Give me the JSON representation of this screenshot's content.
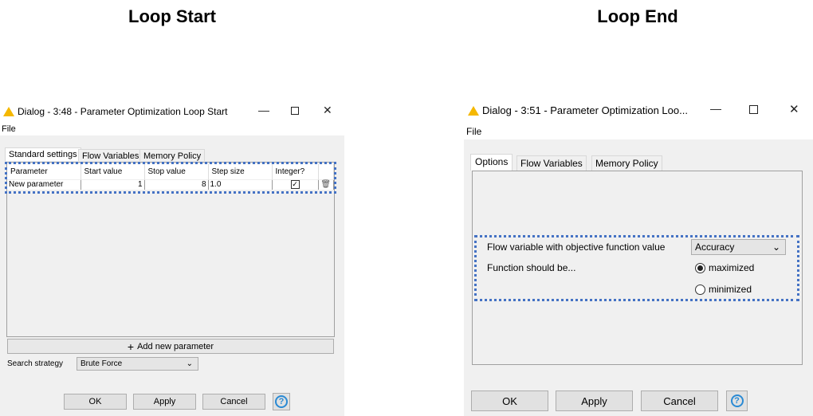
{
  "headings": {
    "left": "Loop Start",
    "right": "Loop End"
  },
  "left": {
    "title": "Dialog - 3:48 - Parameter Optimization Loop Start",
    "menu": "File",
    "tabs": [
      "Standard settings",
      "Flow Variables",
      "Memory Policy"
    ],
    "columns": [
      "Parameter",
      "Start value",
      "Stop value",
      "Step size",
      "Integer?"
    ],
    "rows": [
      {
        "parameter": "New parameter",
        "start": "1",
        "stop": "8",
        "step": "1.0",
        "integer": true
      }
    ],
    "add_label": "Add new parameter",
    "search_label": "Search strategy",
    "search_value": "Brute Force",
    "buttons": {
      "ok": "OK",
      "apply": "Apply",
      "cancel": "Cancel",
      "help": "?"
    }
  },
  "right": {
    "title": "Dialog - 3:51 - Parameter Optimization Loo...",
    "menu": "File",
    "tabs": [
      "Options",
      "Flow Variables",
      "Memory Policy"
    ],
    "flow_var_label": "Flow variable with objective function value",
    "flow_var_value": "Accuracy",
    "function_label": "Function should be...",
    "options": [
      "maximized",
      "minimized"
    ],
    "selected": "maximized",
    "buttons": {
      "ok": "OK",
      "apply": "Apply",
      "cancel": "Cancel",
      "help": "?"
    }
  },
  "colors": {
    "highlight": "#4472c4",
    "warning": "#f5b800"
  }
}
